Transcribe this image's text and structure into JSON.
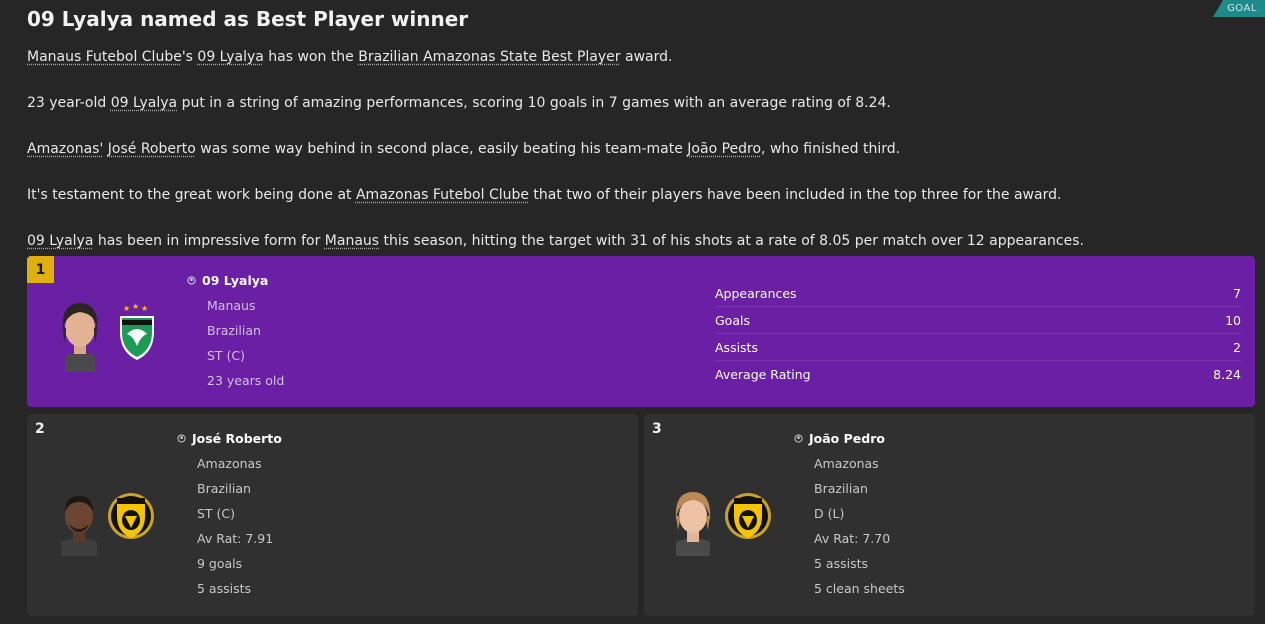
{
  "tag": "GOAL",
  "headline": "09 Lyalya named as Best Player winner",
  "paragraphs": {
    "p1": {
      "club": "Manaus Futebol Clube",
      "apos": "'s ",
      "player": "09 Lyalya",
      "t1": " has won the ",
      "award": "Brazilian Amazonas State Best Player",
      "t2": " award."
    },
    "p2": {
      "t1": "23 year-old ",
      "player": "09 Lyalya",
      "t2": " put in a string of amazing performances, scoring 10 goals in 7 games with an average rating of 8.24."
    },
    "p3": {
      "club": "Amazonas'",
      "t0": " ",
      "player": "José Roberto",
      "t1": " was some way behind in second place, easily beating his team-mate ",
      "mate": "João Pedro",
      "t2": ", who finished third."
    },
    "p4": {
      "t1": "It's testament to the great work being done at ",
      "club": "Amazonas Futebol Clube",
      "t2": " that two of their players have been included in the top three for the award."
    },
    "p5": {
      "player": "09 Lyalya",
      "t1": " has been in impressive form for ",
      "club": "Manaus",
      "t2": " this season, hitting the target with 31 of his shots at a rate of 8.05 per match over 12 appearances."
    }
  },
  "winner": {
    "rank": "1",
    "name": "09 Lyalya",
    "club": "Manaus",
    "nationality": "Brazilian",
    "position": "ST (C)",
    "age": "23 years old",
    "stats": [
      {
        "label": "Appearances",
        "value": "7"
      },
      {
        "label": "Goals",
        "value": "10"
      },
      {
        "label": "Assists",
        "value": "2"
      },
      {
        "label": "Average Rating",
        "value": "8.24"
      }
    ]
  },
  "runners_up": [
    {
      "rank": "2",
      "name": "José Roberto",
      "club": "Amazonas",
      "nationality": "Brazilian",
      "position": "ST (C)",
      "rating": "Av Rat: 7.91",
      "line1": "9 goals",
      "line2": "5 assists"
    },
    {
      "rank": "3",
      "name": "João Pedro",
      "club": "Amazonas",
      "nationality": "Brazilian",
      "position": "D (L)",
      "rating": "Av Rat: 7.70",
      "line1": "5 assists",
      "line2": "5 clean sheets"
    }
  ],
  "colors": {
    "accent_purple": "#6a1fa5",
    "rank_gold": "#e0b10e",
    "goal_teal": "#1f8a8a"
  },
  "icons": [
    "person-icon",
    "player-face",
    "manaus-crest",
    "amazonas-crest"
  ]
}
